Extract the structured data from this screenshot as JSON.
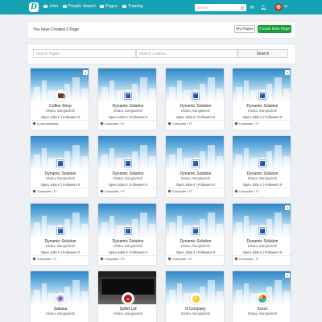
{
  "topbar": {
    "logo_letter": "D",
    "nav": [
      {
        "label": "Jobs",
        "icon": "briefcase-icon"
      },
      {
        "label": "People Search",
        "icon": "people-icon"
      },
      {
        "label": "Pages",
        "icon": "flag-icon"
      },
      {
        "label": "Training",
        "icon": "graduation-cap-icon"
      }
    ],
    "search_placeholder": "Search",
    "icons": [
      "mail-icon",
      "bell-icon",
      "settings-icon"
    ],
    "accent_color": "#16a2b2"
  },
  "summary": {
    "created_text": "You have Created 2 Page",
    "my_pages_label": "My Pages",
    "create_page_label": "Create New Page"
  },
  "filters": {
    "pages_placeholder": "Search Pages...",
    "location_placeholder": "Search Location...",
    "search_label": "Search"
  },
  "pages": [
    {
      "name": "Coffee Shop",
      "location": "Dhaka, Bangladesh",
      "stats": "Open Jobs 0 | Followers 0",
      "category": "Local business",
      "logo": "coffee-cup-logo",
      "editable": true
    },
    {
      "name": "Dynamic Solution",
      "location": "Dhaka, Bangladesh",
      "stats": "Open Jobs 0 | Followers 0",
      "category": "Computer / IT",
      "logo": "cube-logo",
      "editable": false
    },
    {
      "name": "Dynamic Solution",
      "location": "Dhaka, Bangladesh",
      "stats": "Open Jobs 0 | Followers 0",
      "category": "Computer / IT",
      "logo": "cube-logo",
      "editable": false
    },
    {
      "name": "Dynamic Solution",
      "location": "Dhaka, Bangladesh",
      "stats": "Open Jobs 0 | Followers 0",
      "category": "Computer / IT",
      "logo": "cube-logo",
      "editable": true
    },
    {
      "name": "Dynamic Solution",
      "location": "Dhaka, Bangladesh",
      "stats": "Open Jobs 0 | Followers 0",
      "category": "Computer / IT",
      "logo": "cube-logo",
      "editable": false
    },
    {
      "name": "Dynamic Solution",
      "location": "Dhaka, Bangladesh",
      "stats": "Open Jobs 0 | Followers 0",
      "category": "Computer / IT",
      "logo": "cube-logo",
      "editable": false
    },
    {
      "name": "Dynamic Solution",
      "location": "Dhaka, Bangladesh",
      "stats": "Open Jobs 0 | Followers 0",
      "category": "Computer / IT",
      "logo": "cube-logo",
      "editable": false
    },
    {
      "name": "Dynamic Solution",
      "location": "Dhaka, Bangladesh",
      "stats": "Open Jobs 0 | Followers 0",
      "category": "Computer / IT",
      "logo": "cube-logo",
      "editable": false
    },
    {
      "name": "Dynamic Solution",
      "location": "Dhaka, Bangladesh",
      "stats": "Open Jobs 0 | Followers 0",
      "category": "Computer / IT",
      "logo": "cube-logo",
      "editable": false
    },
    {
      "name": "Dynamic Solution",
      "location": "Dhaka, Bangladesh",
      "stats": "Open Jobs 0 | Followers 0",
      "category": "Computer / IT",
      "logo": "cube-logo",
      "editable": false
    },
    {
      "name": "Dynamic Solution",
      "location": "Dhaka, Bangladesh",
      "stats": "Open Jobs 0 | Followers 0",
      "category": "Computer / IT",
      "logo": "cube-logo",
      "editable": false
    },
    {
      "name": "Dynamic Solution",
      "location": "Dhaka, Bangladesh",
      "stats": "Open Jobs 0 | Followers 0",
      "category": "Computer / IT",
      "logo": "cube-logo",
      "editable": true
    },
    {
      "name": "Sakasa",
      "location": "Dhaka, Bangladesh",
      "stats": "",
      "category": "",
      "logo": "circle-logo",
      "editable": false
    },
    {
      "name": "Syftet Ltd",
      "location": "Dhaka, Bangladesh",
      "stats": "",
      "category": "",
      "logo": "brand-logo",
      "editable": false
    },
    {
      "name": "It Company",
      "location": "Dhaka, Bangladesh",
      "stats": "",
      "category": "",
      "logo": "emoji-logo",
      "editable": false
    },
    {
      "name": "Xcxcx",
      "location": "Dhaka, Bangladesh",
      "stats": "",
      "category": "",
      "logo": "color-ring-logo",
      "editable": true
    }
  ]
}
